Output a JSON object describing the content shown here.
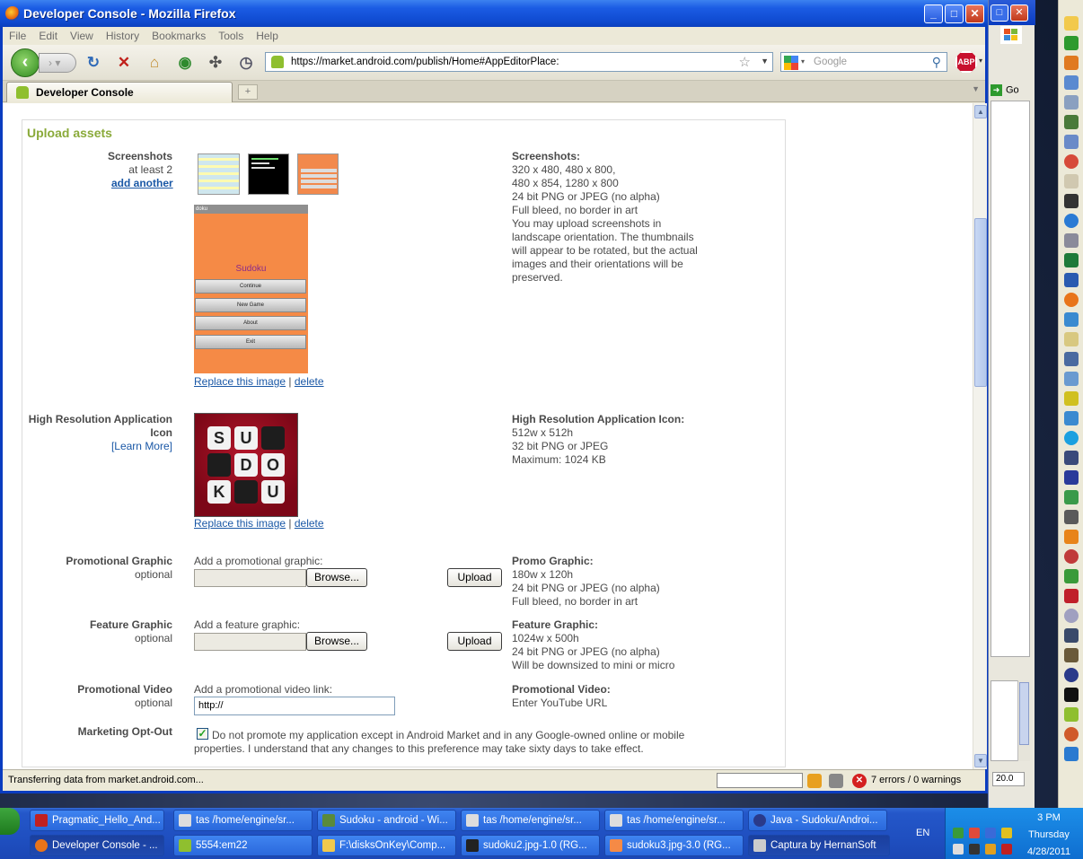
{
  "window": {
    "title": "Developer Console - Mozilla Firefox",
    "minimize": "_",
    "maximize": "□",
    "close": "✕"
  },
  "menu": [
    "File",
    "Edit",
    "View",
    "History",
    "Bookmarks",
    "Tools",
    "Help"
  ],
  "nav": {
    "url": "https://market.android.com/publish/Home#AppEditorPlace:",
    "search_placeholder": "Google",
    "abp_label": "ABP"
  },
  "tab": {
    "label": "Developer Console",
    "new_tab": "+"
  },
  "page": {
    "section_title": "Upload assets",
    "screenshots": {
      "label": "Screenshots",
      "sub": "at least 2",
      "add_link": "add another",
      "replace_link": "Replace this image",
      "separator": " | ",
      "delete_link": "delete",
      "preview_app_name": "Sudoku",
      "preview_bar": "doku",
      "preview_menu": [
        "Continue",
        "New Game",
        "About",
        "Exit"
      ],
      "info_title": "Screenshots:",
      "info_lines": [
        "320 x 480, 480 x 800,",
        "480 x 854, 1280 x 800",
        "24 bit PNG or JPEG (no alpha)",
        "Full bleed, no border in art",
        "You may upload screenshots in",
        "landscape orientation. The thumbnails",
        "will appear to be rotated, but the actual",
        "images and their orientations will be",
        "preserved."
      ]
    },
    "hires_icon": {
      "label_line1": "High Resolution Application",
      "label_line2": "Icon",
      "learn_more": "[Learn More]",
      "replace_link": "Replace this image",
      "delete_link": "delete",
      "icon_letters": [
        "S",
        "U",
        "",
        "",
        "D",
        "O",
        "K",
        "",
        "U"
      ],
      "info_title": "High Resolution Application Icon:",
      "info_lines": [
        "512w x 512h",
        "32 bit PNG or JPEG",
        "Maximum: 1024 KB"
      ]
    },
    "promo_graphic": {
      "label": "Promotional Graphic",
      "sub": "optional",
      "prompt": "Add a promotional graphic:",
      "browse": "Browse...",
      "upload": "Upload",
      "info_title": "Promo Graphic:",
      "info_lines": [
        "180w x 120h",
        "24 bit PNG or JPEG (no alpha)",
        "Full bleed, no border in art"
      ]
    },
    "feature_graphic": {
      "label": "Feature Graphic",
      "sub": "optional",
      "prompt": "Add a feature graphic:",
      "browse": "Browse...",
      "upload": "Upload",
      "info_title": "Feature Graphic:",
      "info_lines": [
        "1024w x 500h",
        "24 bit PNG or JPEG (no alpha)",
        "Will be downsized to mini or micro"
      ]
    },
    "promo_video": {
      "label": "Promotional Video",
      "sub": "optional",
      "prompt": "Add a promotional video link:",
      "value": "http://",
      "info_title": "Promotional Video:",
      "info_lines": [
        "Enter YouTube URL"
      ]
    },
    "marketing_optout": {
      "label": "Marketing Opt-Out",
      "checked": true,
      "text_line1": "Do not promote my application except in Android Market and in any Google-owned online or mobile",
      "text_line2": "properties. I understand that any changes to this preference may take sixty days to take effect."
    }
  },
  "status": {
    "text": "Transferring data from market.android.com...",
    "errors": "7 errors / 0 warnings"
  },
  "bg_window": {
    "go_label": "Go",
    "zoom": "20.0"
  },
  "taskbar": {
    "row1": [
      "Pragmatic_Hello_And...",
      "tas /home/engine/sr...",
      "Sudoku - android - Wi...",
      "tas /home/engine/sr...",
      "tas /home/engine/sr...",
      "Java - Sudoku/Androi..."
    ],
    "row2": [
      "Developer Console - ...",
      "5554:em22",
      "F:\\disksOnKey\\Comp...",
      "sudoku2.jpg-1.0 (RG...",
      "sudoku3.jpg-3.0 (RG...",
      "Captura by HernanSoft"
    ],
    "lang": "EN",
    "time": "3 PM",
    "day": "Thursday",
    "date": "4/28/2011"
  }
}
